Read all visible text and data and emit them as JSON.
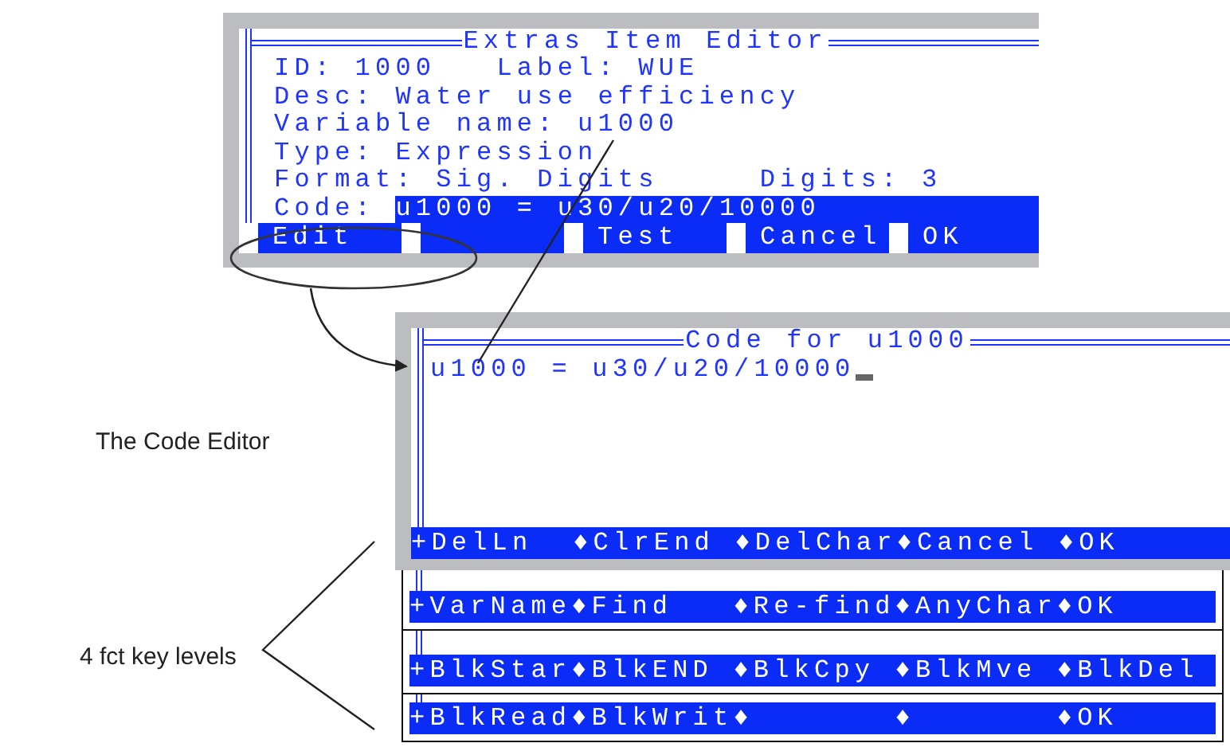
{
  "item_editor": {
    "title": "Extras Item Editor",
    "lines": [
      "ID: 1000   Label: WUE",
      "Desc: Water use efficiency",
      "Variable name: u1000",
      "Type: Expression",
      "Format: Sig. Digits     Digits: 3"
    ],
    "code": {
      "label": "Code:",
      "value": "u1000 = u30/u20/10000"
    },
    "buttons": [
      {
        "kind": "button",
        "label": "Edit"
      },
      {
        "kind": "blank"
      },
      {
        "kind": "button",
        "label": "Test"
      },
      {
        "kind": "button",
        "label": "Cancel"
      },
      {
        "kind": "button",
        "label": "OK"
      }
    ]
  },
  "code_editor": {
    "title": "Code for u1000",
    "text": "u1000 = u30/u20/10000",
    "cursor": true,
    "keys": [
      "+DelLn",
      "♦ClrEnd",
      "♦DelChar",
      "♦Cancel",
      "♦OK"
    ]
  },
  "key_levels": [
    {
      "keys": [
        "+VarName",
        "♦Find",
        "♦Re-find",
        "♦AnyChar",
        "♦OK"
      ]
    },
    {
      "keys": [
        "+BlkStar",
        "♦BlkEND",
        "♦BlkCpy",
        "♦BlkMve",
        "♦BlkDel"
      ]
    },
    {
      "keys": [
        "+BlkRead",
        "♦BlkWrit",
        "♦",
        "♦",
        "♦OK"
      ]
    }
  ],
  "annotations": {
    "code_editor_label": "The Code Editor",
    "key_levels_label": "4 fct key levels"
  }
}
